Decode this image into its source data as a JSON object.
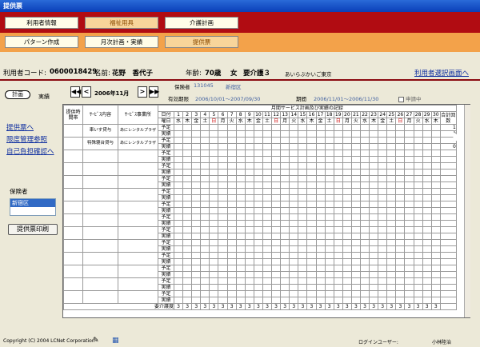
{
  "window_title": "提供票",
  "nav": {
    "user_info": "利用者情報",
    "welfare": "福祉用具",
    "care_plan": "介護計画",
    "pattern": "パターン作成",
    "monthly": "月次計画・実績",
    "teikyo": "提供票"
  },
  "user": {
    "code_label": "利用者コード:",
    "code": "0600018429",
    "name_label": "名前:",
    "name": "花野　香代子",
    "age_label": "年齢:",
    "age": "70歳",
    "sex": "女",
    "care_level": "要介護３",
    "org": "あいらぶかいご東京",
    "select_link": "利用者選択画面へ"
  },
  "left": {
    "plan": "計画",
    "actual": "実績",
    "links": [
      "提供票へ",
      "限度管理参照",
      "自己負担確認へ"
    ],
    "insurer_label": "保険者",
    "insurer_selected": "新宿区",
    "print_button": "提供票印刷"
  },
  "month_nav": {
    "prev2": "◀◀",
    "prev": "<",
    "label": "2006年11月",
    "next": ">",
    "next2": "▶▶"
  },
  "info": {
    "insurer_no_label": "保険者",
    "insurer_no": "131045",
    "insurer_name": "新宿区",
    "valid_label": "有効期限",
    "valid": "2006/10/01〜2007/09/30",
    "period_label": "期間",
    "period": "2006/11/01〜2006/11/30",
    "apply": "申請中"
  },
  "grid": {
    "col_time": "提供時間帯",
    "col_service": "ｻｰﾋﾞｽ内容",
    "col_provider": "ｻｰﾋﾞｽ事業所",
    "header_title": "月間サービス計画及び実績の記録",
    "day_label": "日付",
    "dow_label": "曜日",
    "total_label": "合計回数",
    "days": [
      "1",
      "2",
      "3",
      "4",
      "5",
      "6",
      "7",
      "8",
      "9",
      "10",
      "11",
      "12",
      "13",
      "14",
      "15",
      "16",
      "17",
      "18",
      "19",
      "20",
      "21",
      "22",
      "23",
      "24",
      "25",
      "26",
      "27",
      "28",
      "29",
      "30"
    ],
    "dows": [
      "水",
      "木",
      "金",
      "土",
      "日",
      "月",
      "火",
      "水",
      "木",
      "金",
      "土",
      "日",
      "月",
      "火",
      "水",
      "木",
      "金",
      "土",
      "日",
      "月",
      "火",
      "水",
      "木",
      "金",
      "土",
      "日",
      "月",
      "火",
      "水",
      "木"
    ],
    "plan": "予定",
    "act": "実績",
    "services": [
      {
        "content": "車いす貸与",
        "provider": "あにレンタルプラザ",
        "totals": [
          "1",
          "0"
        ]
      },
      {
        "content": "特殊寝台貸与",
        "provider": "あにレンタルプラザ",
        "totals": [
          "1",
          "0"
        ]
      }
    ],
    "care_level_label": "要介護度",
    "care_level_value": "3"
  },
  "footer": {
    "copyright": "Copyright (C) 2004 LCNet Corporation",
    "login_label": "ログインユーザー:",
    "login_user": "小林陸治"
  }
}
